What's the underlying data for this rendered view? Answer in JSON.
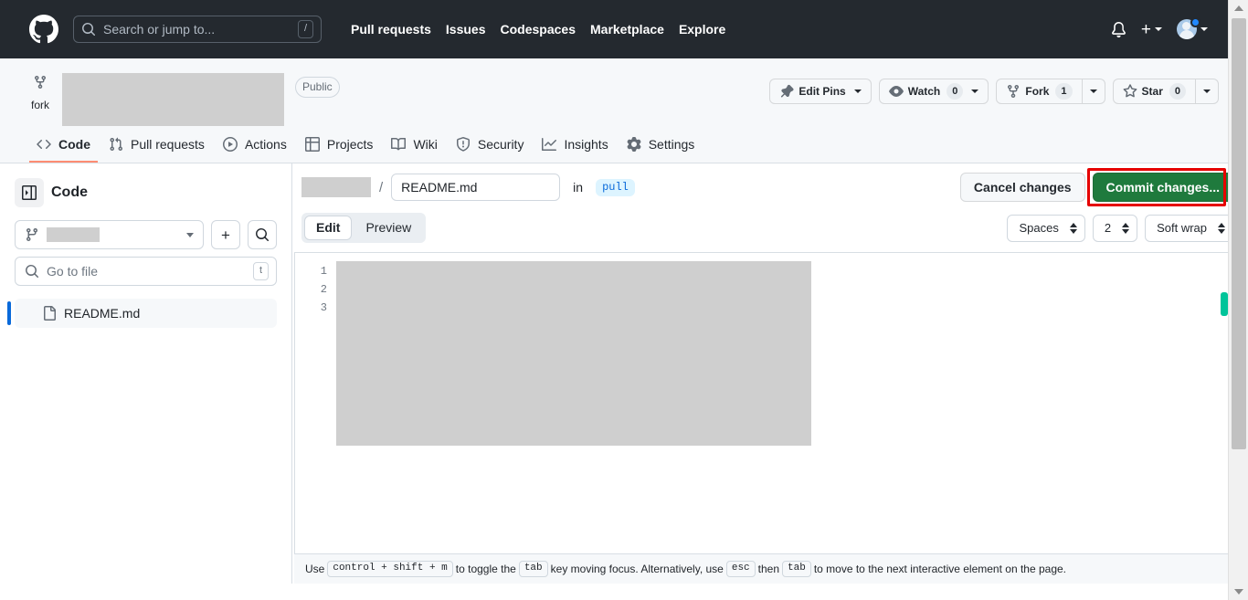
{
  "topbar": {
    "logo_icon": "github-mark-icon",
    "search": {
      "icon": "search-icon",
      "placeholder": "Search or jump to...",
      "shortcut_key": "/"
    },
    "nav": [
      {
        "label": "Pull requests"
      },
      {
        "label": "Issues"
      },
      {
        "label": "Codespaces"
      },
      {
        "label": "Marketplace"
      },
      {
        "label": "Explore"
      }
    ],
    "notifications_icon": "bell-icon",
    "create_new_icon": "plus-icon",
    "create_new_caret": "chevron-down-icon",
    "avatar_icon": "user-avatar",
    "avatar_caret": "chevron-down-icon",
    "notification_dot": true
  },
  "repo": {
    "fork_icon": "repo-forked-icon",
    "fork_label": "fork",
    "name_redacted": true,
    "visibility": "Public",
    "actions": {
      "edit_pins": {
        "label": "Edit Pins",
        "icon": "pin-icon",
        "caret": "chevron-down-icon"
      },
      "watch": {
        "label": "Watch",
        "count": "0",
        "icon": "eye-icon",
        "caret": "chevron-down-icon"
      },
      "fork": {
        "label": "Fork",
        "count": "1",
        "icon": "repo-forked-icon",
        "caret": "chevron-down-icon"
      },
      "star": {
        "label": "Star",
        "count": "0",
        "icon": "star-icon",
        "caret": "chevron-down-icon"
      }
    },
    "tabs": [
      {
        "label": "Code",
        "icon": "code-icon",
        "active": true
      },
      {
        "label": "Pull requests",
        "icon": "git-pull-request-icon",
        "active": false
      },
      {
        "label": "Actions",
        "icon": "play-icon",
        "active": false
      },
      {
        "label": "Projects",
        "icon": "table-icon",
        "active": false
      },
      {
        "label": "Wiki",
        "icon": "book-icon",
        "active": false
      },
      {
        "label": "Security",
        "icon": "shield-icon",
        "active": false
      },
      {
        "label": "Insights",
        "icon": "graph-icon",
        "active": false
      },
      {
        "label": "Settings",
        "icon": "gear-icon",
        "active": false
      }
    ]
  },
  "sidebar": {
    "collapse_icon": "sidebar-collapse-icon",
    "title": "Code",
    "branch_select": {
      "icon": "git-branch-icon",
      "value_redacted": true,
      "caret": "chevron-down-icon"
    },
    "add_button_icon": "plus-icon",
    "search_button_icon": "search-icon",
    "go_to_file": {
      "icon": "search-icon",
      "placeholder": "Go to file",
      "shortcut_key": "t"
    },
    "files": [
      {
        "name": "README.md",
        "icon": "file-icon",
        "selected": true
      }
    ]
  },
  "editor": {
    "breadcrumb_redacted": true,
    "breadcrumb_separator": "/",
    "filename": "README.md",
    "in_label": "in",
    "branch_badge": "pull",
    "cancel_label": "Cancel changes",
    "commit_label": "Commit changes...",
    "commit_highlighted": true,
    "view_tabs": [
      {
        "label": "Edit",
        "active": true
      },
      {
        "label": "Preview",
        "active": false
      }
    ],
    "settings": [
      {
        "name": "indent-mode-select",
        "value": "Spaces"
      },
      {
        "name": "indent-size-select",
        "value": "2"
      },
      {
        "name": "line-wrap-select",
        "value": "Soft wrap"
      }
    ],
    "line_numbers": [
      "1",
      "2",
      "3"
    ],
    "content_redacted": true,
    "footer": {
      "part1": "Use",
      "kbd1": "control + shift + m",
      "part2": "to toggle the",
      "kbd2": "tab",
      "part3": "key moving focus. Alternatively, use",
      "kbd3": "esc",
      "part4": "then",
      "kbd4": "tab",
      "part5": "to move to the next interactive element on the page."
    }
  },
  "colors": {
    "header_bg": "#24292f",
    "accent_blue": "#0969da",
    "commit_green": "#1f7a3d",
    "highlight_red": "#e60000",
    "tab_underline": "#fd8c73",
    "marker_green": "#00c49a"
  }
}
